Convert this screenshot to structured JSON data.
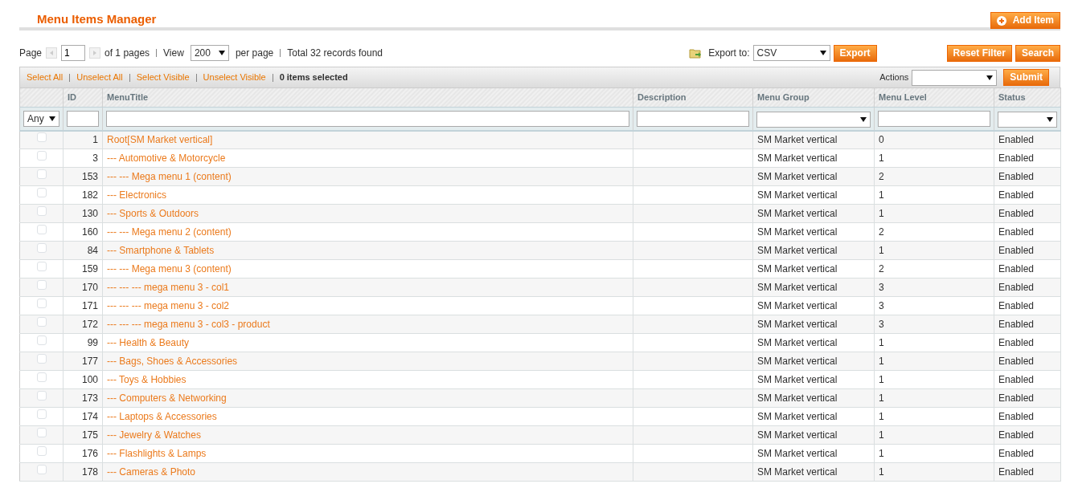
{
  "header": {
    "title": "Menu Items Manager",
    "add_button": "Add Item"
  },
  "pager": {
    "page_label": "Page",
    "page": "1",
    "of_pages": "of 1 pages",
    "view_label": "View",
    "per_page": "200",
    "per_page_label": "per page",
    "total": "Total 32 records found"
  },
  "export": {
    "label": "Export to:",
    "format": "CSV",
    "button": "Export"
  },
  "grid_buttons": [
    "Reset Filter",
    "Search"
  ],
  "massaction": {
    "links": [
      "Select All",
      "Unselect All",
      "Select Visible",
      "Unselect Visible"
    ],
    "count": "0 items selected",
    "actions_label": "Actions",
    "submit": "Submit"
  },
  "table": {
    "columns": [
      "",
      "ID",
      "MenuTitle",
      "Description",
      "Menu Group",
      "Menu Level",
      "Status"
    ],
    "filters": [
      {
        "kind": "select",
        "value": "Any"
      },
      {
        "kind": "input"
      },
      {
        "kind": "input"
      },
      {
        "kind": "input"
      },
      {
        "kind": "select"
      },
      {
        "kind": "input"
      },
      {
        "kind": "select"
      }
    ],
    "rows": [
      {
        "checked": false,
        "id": "1",
        "title": "Root[SM Market vertical]",
        "group": "SM Market vertical",
        "level": "0",
        "status": "Enabled"
      },
      {
        "checked": false,
        "id": "3",
        "title": "--- Automotive & Motorcycle",
        "group": "SM Market vertical",
        "level": "1",
        "status": "Enabled"
      },
      {
        "checked": false,
        "id": "153",
        "title": "--- --- Mega menu 1 (content)",
        "group": "SM Market vertical",
        "level": "2",
        "status": "Enabled"
      },
      {
        "checked": false,
        "id": "182",
        "title": "--- Electronics",
        "group": "SM Market vertical",
        "level": "1",
        "status": "Enabled"
      },
      {
        "checked": false,
        "id": "130",
        "title": "--- Sports & Outdoors",
        "group": "SM Market vertical",
        "level": "1",
        "status": "Enabled"
      },
      {
        "checked": false,
        "id": "160",
        "title": "--- --- Mega menu 2 (content)",
        "group": "SM Market vertical",
        "level": "2",
        "status": "Enabled"
      },
      {
        "checked": false,
        "id": "84",
        "title": "--- Smartphone & Tablets",
        "group": "SM Market vertical",
        "level": "1",
        "status": "Enabled"
      },
      {
        "checked": false,
        "id": "159",
        "title": "--- --- Mega menu 3 (content)",
        "group": "SM Market vertical",
        "level": "2",
        "status": "Enabled"
      },
      {
        "checked": false,
        "id": "170",
        "title": "--- --- --- mega menu 3 - col1",
        "group": "SM Market vertical",
        "level": "3",
        "status": "Enabled"
      },
      {
        "checked": false,
        "id": "171",
        "title": "--- --- --- mega menu 3 - col2",
        "group": "SM Market vertical",
        "level": "3",
        "status": "Enabled"
      },
      {
        "checked": false,
        "id": "172",
        "title": "--- --- --- mega menu 3 - col3 - product",
        "group": "SM Market vertical",
        "level": "3",
        "status": "Enabled"
      },
      {
        "checked": false,
        "id": "99",
        "title": "--- Health & Beauty",
        "group": "SM Market vertical",
        "level": "1",
        "status": "Enabled"
      },
      {
        "checked": false,
        "id": "177",
        "title": "--- Bags, Shoes & Accessories",
        "group": "SM Market vertical",
        "level": "1",
        "status": "Enabled"
      },
      {
        "checked": false,
        "id": "100",
        "title": "--- Toys & Hobbies",
        "group": "SM Market vertical",
        "level": "1",
        "status": "Enabled"
      },
      {
        "checked": false,
        "id": "173",
        "title": "--- Computers & Networking",
        "group": "SM Market vertical",
        "level": "1",
        "status": "Enabled"
      },
      {
        "checked": false,
        "id": "174",
        "title": "--- Laptops & Accessories",
        "group": "SM Market vertical",
        "level": "1",
        "status": "Enabled"
      },
      {
        "checked": false,
        "id": "175",
        "title": "--- Jewelry & Watches",
        "group": "SM Market vertical",
        "level": "1",
        "status": "Enabled"
      },
      {
        "checked": false,
        "id": "176",
        "title": "--- Flashlights & Lamps",
        "group": "SM Market vertical",
        "level": "1",
        "status": "Enabled"
      },
      {
        "checked": false,
        "id": "178",
        "title": "--- Cameras & Photo",
        "group": "SM Market vertical",
        "level": "1",
        "status": "Enabled"
      }
    ]
  }
}
